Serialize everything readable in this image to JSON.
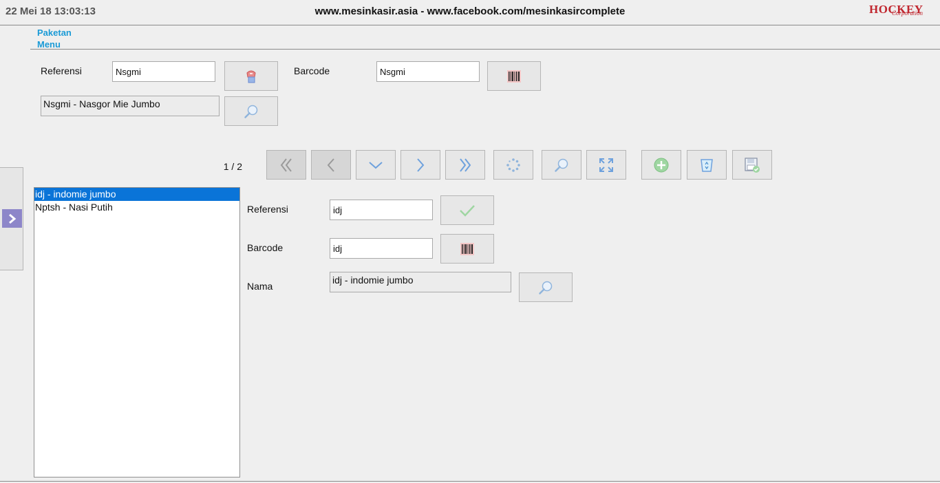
{
  "header": {
    "datetime": "22 Mei 18 13:03:13",
    "site_title": "www.mesinkasir.asia - www.facebook.com/mesinkasircomplete",
    "logo_text": "HOCKEY",
    "logo_sub": "Corporation"
  },
  "breadcrumb": {
    "text": "Paketan Menu"
  },
  "filter": {
    "referensi_label": "Referensi",
    "referensi_value": "Nsgmi",
    "barcode_label": "Barcode",
    "barcode_value": "Nsgmi",
    "product_value": "Nsgmi - Nasgor Mie Jumbo"
  },
  "pager": {
    "text": "1 / 2"
  },
  "toolbar": {
    "icons": [
      "first-icon",
      "previous-icon",
      "down-icon",
      "next-icon",
      "last-icon",
      "reload-icon",
      "search-icon",
      "fullscreen-icon",
      "add-icon",
      "delete-icon",
      "save-icon"
    ]
  },
  "list": {
    "items": [
      {
        "label": "idj - indomie jumbo",
        "selected": true
      },
      {
        "label": "Nptsh - Nasi Putih",
        "selected": false
      }
    ]
  },
  "detail": {
    "referensi_label": "Referensi",
    "referensi_value": "idj",
    "barcode_label": "Barcode",
    "barcode_value": "idj",
    "nama_label": "Nama",
    "nama_value": "idj - indomie jumbo"
  },
  "colors": {
    "accent": "#1a9ad6",
    "selected": "#0a74d8",
    "logo": "#c0262e",
    "side_toggle": "#8d86c9"
  }
}
